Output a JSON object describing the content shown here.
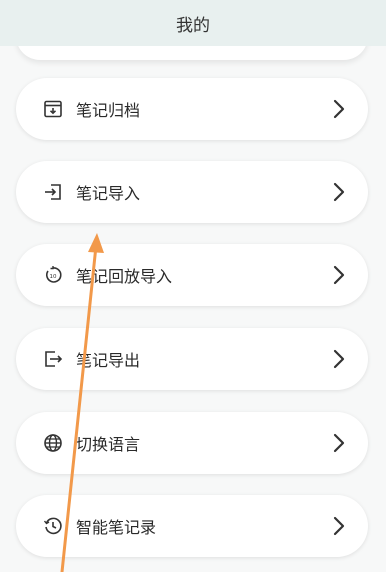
{
  "header": {
    "title": "我的"
  },
  "menu": {
    "items": [
      {
        "label": "笔记归档",
        "icon": "archive-icon"
      },
      {
        "label": "笔记导入",
        "icon": "import-icon"
      },
      {
        "label": "笔记回放导入",
        "icon": "replay-icon"
      },
      {
        "label": "笔记导出",
        "icon": "export-icon"
      },
      {
        "label": "切换语言",
        "icon": "globe-icon"
      },
      {
        "label": "智能笔记录",
        "icon": "history-icon"
      }
    ]
  },
  "annotation": {
    "arrow_color": "#f2994a",
    "arrow_target": "笔记导入"
  },
  "colors": {
    "header_bg": "#e8f0ef",
    "page_bg": "#f7f8f8",
    "card_bg": "#ffffff"
  }
}
